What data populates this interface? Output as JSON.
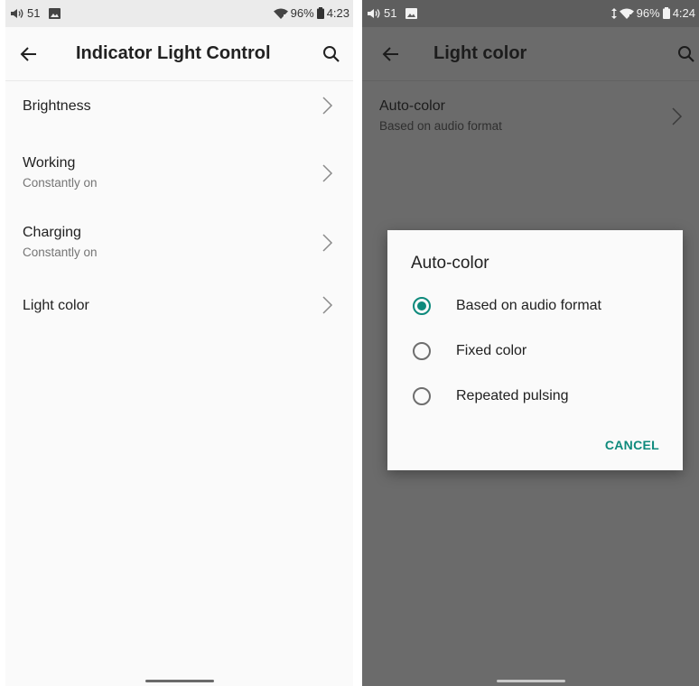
{
  "left": {
    "status": {
      "volume": "51",
      "battery": "96%",
      "time": "4:23"
    },
    "title": "Indicator Light Control",
    "items": [
      {
        "label": "Brightness",
        "sub": ""
      },
      {
        "label": "Working",
        "sub": "Constantly on"
      },
      {
        "label": "Charging",
        "sub": "Constantly on"
      },
      {
        "label": "Light color",
        "sub": ""
      }
    ]
  },
  "right": {
    "status": {
      "volume": "51",
      "battery": "96%",
      "time": "4:24"
    },
    "title": "Light color",
    "items": [
      {
        "label": "Auto-color",
        "sub": "Based on audio format"
      }
    ],
    "dialog": {
      "title": "Auto-color",
      "options": [
        {
          "label": "Based on audio format",
          "selected": true
        },
        {
          "label": "Fixed color",
          "selected": false
        },
        {
          "label": "Repeated pulsing",
          "selected": false
        }
      ],
      "cancel_label": "CANCEL"
    }
  },
  "icons": {
    "back": "back-arrow-icon",
    "search": "search-icon",
    "chevron": "chevron-right-icon",
    "volume": "volume-icon",
    "image": "image-icon",
    "wifi": "wifi-icon",
    "battery": "battery-icon"
  },
  "colors": {
    "accent": "#0e8a7c",
    "scrim": "#6b6b6b"
  }
}
